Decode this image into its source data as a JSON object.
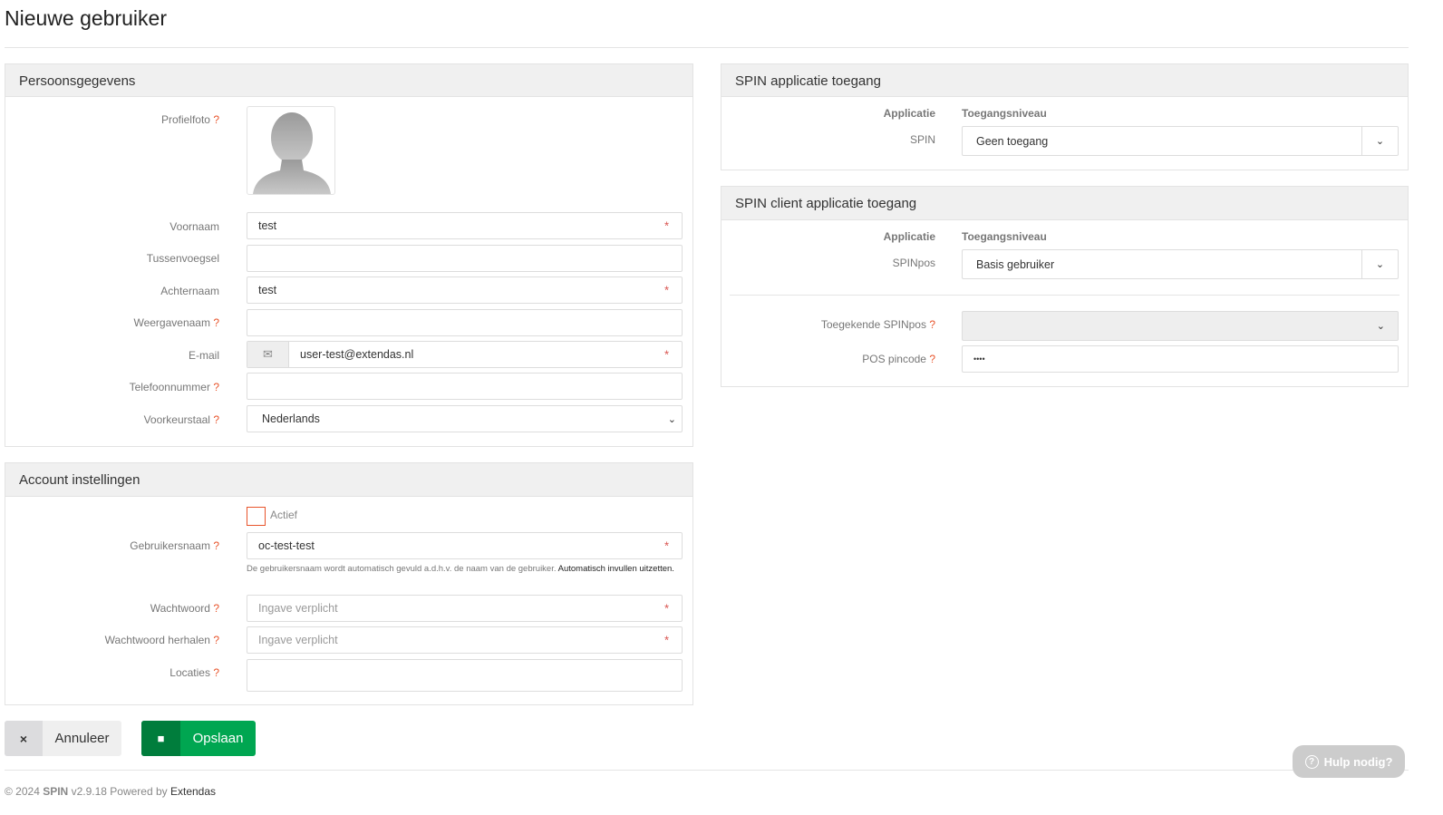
{
  "title": "Nieuwe gebruiker",
  "personal": {
    "header": "Persoonsgegevens",
    "profile_label": "Profielfoto",
    "q": "?",
    "required": "*",
    "first_name_label": "Voornaam",
    "first_name": "test",
    "infix_label": "Tussenvoegsel",
    "infix": "",
    "last_name_label": "Achternaam",
    "last_name": "test",
    "display_label": "Weergavenaam",
    "display": "",
    "email_label": "E-mail",
    "email": "user-test@extendas.nl",
    "phone_label": "Telefoonnummer",
    "phone": "",
    "language_label": "Voorkeurstaal",
    "language": "Nederlands"
  },
  "account": {
    "header": "Account instellingen",
    "active_label": "Actief",
    "username_label": "Gebruikersnaam",
    "username": "oc-test-test",
    "help_text": "De gebruikersnaam wordt automatisch gevuld a.d.h.v. de naam van de gebruiker.",
    "help_link": "Automatisch invullen uitzetten.",
    "password_label": "Wachtwoord",
    "password_placeholder": "Ingave verplicht",
    "password_repeat_label": "Wachtwoord herhalen",
    "password_repeat_placeholder": "Ingave verplicht",
    "locations_label": "Locaties"
  },
  "spin_access": {
    "header": "SPIN applicatie toegang",
    "col_app": "Applicatie",
    "col_level": "Toegangsniveau",
    "app": "SPIN",
    "level": "Geen toegang"
  },
  "client_access": {
    "header": "SPIN client applicatie toegang",
    "col_app": "Applicatie",
    "col_level": "Toegangsniveau",
    "app": "SPINpos",
    "level": "Basis gebruiker",
    "assigned_label": "Toegekende SPINpos",
    "assigned": "",
    "pin_label": "POS pincode",
    "pin": "••••"
  },
  "buttons": {
    "cancel": "Annuleer",
    "save": "Opslaan",
    "help": "Hulp nodig?"
  },
  "footer": {
    "copy": "© 2024",
    "brand": "SPIN",
    "version": "v2.9.18 Powered by",
    "company": "Extendas"
  },
  "colors": {
    "save": "#00a651",
    "save_dark": "#007d3c",
    "required": "#d9534f",
    "question": "#e8542b"
  }
}
